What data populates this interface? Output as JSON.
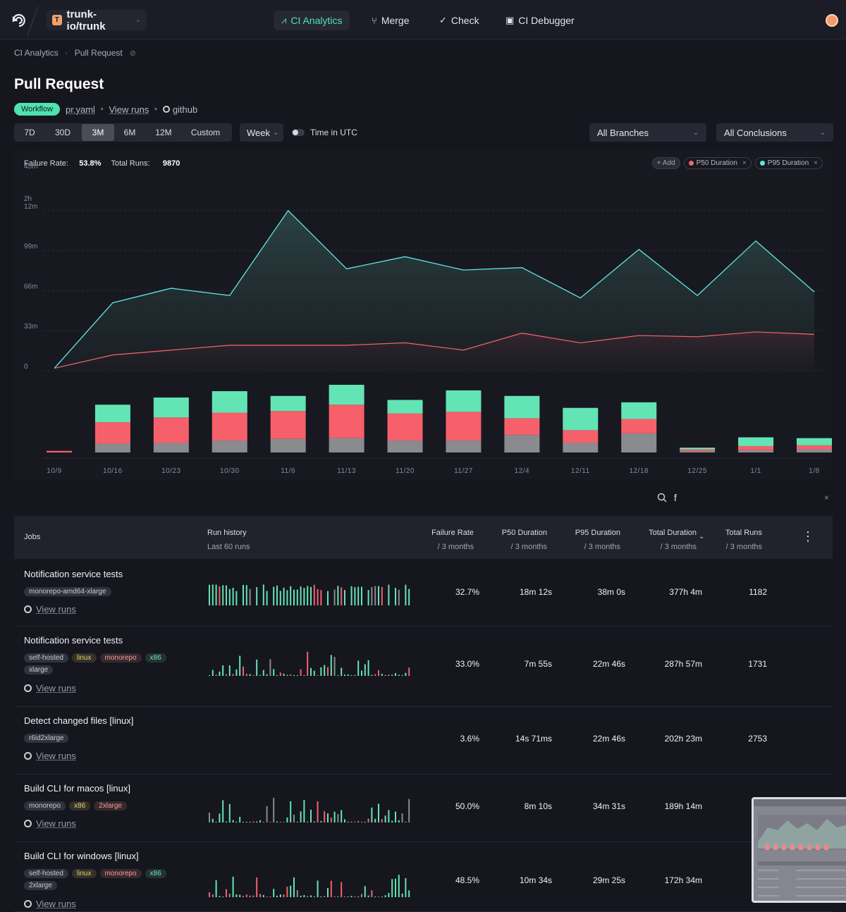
{
  "nav": {
    "repo_initial": "T",
    "repo": "trunk-io/trunk",
    "tabs": [
      {
        "label": "CI Analytics",
        "icon": "analytics-icon",
        "active": true
      },
      {
        "label": "Merge",
        "icon": "merge-icon",
        "active": false
      },
      {
        "label": "Check",
        "icon": "check-circle-icon",
        "active": false
      },
      {
        "label": "CI Debugger",
        "icon": "terminal-icon",
        "active": false
      }
    ]
  },
  "breadcrumb": [
    "CI Analytics",
    "Pull Request"
  ],
  "page": {
    "title": "Pull Request",
    "badge": "Workflow",
    "file": "pr.yaml",
    "view_runs": "View runs",
    "source": "github"
  },
  "controls": {
    "ranges": [
      "7D",
      "30D",
      "3M",
      "6M",
      "12M",
      "Custom"
    ],
    "selected_range": "3M",
    "granularity": "Week",
    "utc_label": "Time in UTC",
    "branches": "All Branches",
    "conclusions": "All Conclusions"
  },
  "stats": {
    "failure_rate_label": "Failure Rate:",
    "failure_rate": "53.8%",
    "total_runs_label": "Total Runs:",
    "total_runs": "9870"
  },
  "legend": {
    "add": "+ Add",
    "series": [
      {
        "name": "P50 Duration",
        "color": "#f3666a"
      },
      {
        "name": "P95 Duration",
        "color": "#5ee6e6"
      }
    ]
  },
  "chart_data": [
    {
      "type": "area",
      "x": [
        "10/9",
        "10/16",
        "10/23",
        "10/30",
        "11/6",
        "11/13",
        "11/20",
        "11/27",
        "12/4",
        "12/11",
        "12/18",
        "12/25",
        "1/1",
        "1/8"
      ],
      "y_tick_labels": [
        "0",
        "33m",
        "66m",
        "99m",
        "2h\n12m",
        "45m"
      ],
      "ylim_minutes": [
        0,
        165
      ],
      "series": [
        {
          "name": "P95 Duration",
          "color": "#5ee6e6",
          "values_minutes": [
            2,
            56,
            68,
            62,
            132,
            84,
            94,
            83,
            85,
            60,
            100,
            62,
            107,
            65
          ]
        },
        {
          "name": "P50 Duration",
          "color": "#f3666a",
          "values_minutes": [
            2,
            13,
            17,
            21,
            21,
            21,
            23,
            17,
            31,
            23,
            29,
            28,
            32,
            30
          ]
        }
      ],
      "grid": true
    },
    {
      "type": "bar",
      "stacked": true,
      "categories": [
        "10/9",
        "10/16",
        "10/23",
        "10/30",
        "11/6",
        "11/13",
        "11/20",
        "11/27",
        "12/4",
        "12/11",
        "12/18",
        "12/25",
        "1/1",
        "1/8"
      ],
      "series": [
        {
          "name": "other",
          "color": "#8a8b8f",
          "values": [
            0,
            11,
            12,
            15,
            17,
            18,
            15,
            15,
            22,
            12,
            24,
            2,
            3,
            4
          ]
        },
        {
          "name": "failure",
          "color": "#f5606a",
          "values": [
            2,
            27,
            32,
            35,
            35,
            42,
            34,
            36,
            21,
            16,
            18,
            2,
            5,
            5
          ]
        },
        {
          "name": "success",
          "color": "#63e4b5",
          "values": [
            0,
            22,
            25,
            27,
            19,
            25,
            17,
            27,
            28,
            28,
            21,
            2,
            11,
            9
          ]
        }
      ]
    }
  ],
  "search": {
    "value": "f"
  },
  "table": {
    "headers": {
      "jobs": "Jobs",
      "run_history": "Run history",
      "run_history_sub": "Last 60 runs",
      "failure_rate": "Failure Rate",
      "p50": "P50 Duration",
      "p95": "P95 Duration",
      "total_duration": "Total Duration",
      "total_runs": "Total Runs",
      "period": "/ 3 months"
    },
    "rows": [
      {
        "name": "Notification service tests",
        "tags": [
          {
            "t": "monorepo-amd64-xlarge",
            "c": ""
          }
        ],
        "view_runs": "View runs",
        "failure_rate": "32.7%",
        "p50": "18m 12s",
        "p95": "38m 0s",
        "total_duration": "377h 4m",
        "total_runs": "1182"
      },
      {
        "name": "Notification service tests",
        "tags": [
          {
            "t": "self-hosted",
            "c": ""
          },
          {
            "t": "linux",
            "c": "t-yellow"
          },
          {
            "t": "monorepo",
            "c": "t-pink"
          },
          {
            "t": "x86",
            "c": "t-green"
          },
          {
            "t": "xlarge",
            "c": ""
          }
        ],
        "view_runs": "View runs",
        "failure_rate": "33.0%",
        "p50": "7m 55s",
        "p95": "22m 46s",
        "total_duration": "287h 57m",
        "total_runs": "1731"
      },
      {
        "name": "Detect changed files [linux]",
        "tags": [
          {
            "t": "r6id2xlarge",
            "c": ""
          }
        ],
        "view_runs": "View runs",
        "failure_rate": "3.6%",
        "p50": "14s 71ms",
        "p95": "22m 46s",
        "total_duration": "202h 23m",
        "total_runs": "2753"
      },
      {
        "name": "Build CLI for macos [linux]",
        "tags": [
          {
            "t": "monorepo",
            "c": ""
          },
          {
            "t": "x86",
            "c": "t-yellow"
          },
          {
            "t": "2xlarge",
            "c": "t-pink"
          }
        ],
        "view_runs": "View runs",
        "failure_rate": "50.0%",
        "p50": "8m 10s",
        "p95": "34m 31s",
        "total_duration": "189h 14m",
        "total_runs": ""
      },
      {
        "name": "Build CLI for windows [linux]",
        "tags": [
          {
            "t": "self-hosted",
            "c": ""
          },
          {
            "t": "linux",
            "c": "t-yellow"
          },
          {
            "t": "monorepo",
            "c": "t-pink"
          },
          {
            "t": "x86",
            "c": "t-green"
          },
          {
            "t": "2xlarge",
            "c": ""
          }
        ],
        "view_runs": "View runs",
        "failure_rate": "48.5%",
        "p50": "10m 34s",
        "p95": "29m 25s",
        "total_duration": "172h 34m",
        "total_runs": ""
      }
    ]
  }
}
